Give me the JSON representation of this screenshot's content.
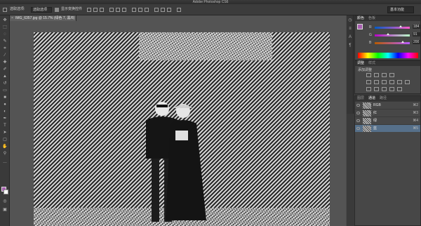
{
  "app": {
    "title": "Adobe Photoshop CS6"
  },
  "options_bar": {
    "tool_label": "选取选项:",
    "mode_value": "选取选项",
    "transform_label": "显示变换控件",
    "workspace": "基本功能"
  },
  "document": {
    "tab_title": "IMG_6357.jpg @ 15.7% (绿色 7, 黑/8)"
  },
  "tools": {
    "fg_color": "#a95fb1",
    "bg_color": "#ffffff"
  },
  "color_panel": {
    "tabs": [
      "颜色",
      "色板"
    ],
    "channels": [
      {
        "label": "R",
        "value": "184"
      },
      {
        "label": "G",
        "value": "91"
      },
      {
        "label": "B",
        "value": "200"
      }
    ]
  },
  "adjustments_panel": {
    "tabs": [
      "调整",
      "样式"
    ],
    "label": "添加调整"
  },
  "channels_panel": {
    "tabs": [
      "图层",
      "通道",
      "路径"
    ],
    "rows": [
      {
        "name": "RGB",
        "shortcut": "⌘2",
        "selected": false
      },
      {
        "name": "红",
        "shortcut": "⌘3",
        "selected": false
      },
      {
        "name": "绿",
        "shortcut": "⌘4",
        "selected": false
      },
      {
        "name": "蓝",
        "shortcut": "⌘5",
        "selected": true
      }
    ]
  }
}
